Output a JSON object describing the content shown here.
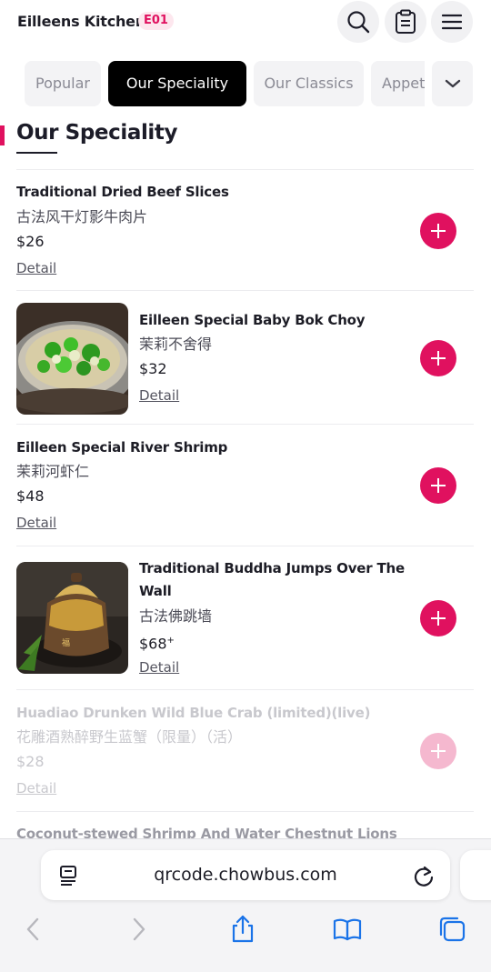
{
  "header": {
    "restaurant_name": "Eilleens Kitchen",
    "table_code": "E01",
    "icons": [
      "search-icon",
      "order-clipboard-icon",
      "menu-hamburger-icon"
    ]
  },
  "tabs": [
    {
      "label": "Popular",
      "active": false
    },
    {
      "label": "Our Speciality",
      "active": true
    },
    {
      "label": "Our Classics",
      "active": false
    },
    {
      "label": "Appetizers",
      "active": false
    }
  ],
  "section": {
    "title": "Our Speciality"
  },
  "items": [
    {
      "name": "Traditional Dried Beef Slices",
      "name_cn": "古法风干灯影牛肉片",
      "price": "$26",
      "detail_label": "Detail",
      "has_image": false,
      "available": true
    },
    {
      "name": "Eilleen Special Baby Bok Choy",
      "name_cn": "茉莉不舍得",
      "price": "$32",
      "detail_label": "Detail",
      "has_image": true,
      "image": "bok-choy-soup-photo",
      "available": true
    },
    {
      "name": "Eilleen Special River Shrimp",
      "name_cn": "茉莉河虾仁",
      "price": "$48",
      "detail_label": "Detail",
      "has_image": false,
      "available": true
    },
    {
      "name": "Traditional Buddha Jumps Over The Wall",
      "name_cn": "古法佛跳墙",
      "price": "$68",
      "price_suffix": "+",
      "detail_label": "Detail",
      "has_image": true,
      "image": "buddha-jumps-over-wall-photo",
      "available": true
    },
    {
      "name": "Huadiao Drunken Wild Blue Crab (limited)(live)",
      "name_cn": "花雕酒熟醉野生蓝蟹（限量）（活）",
      "price": "$28",
      "detail_label": "Detail",
      "has_image": false,
      "available": false
    },
    {
      "name": "Coconut-stewed Shrimp And Water Chestnut Lions",
      "available": true
    }
  ],
  "browser": {
    "url": "qrcode.chowbus.com",
    "icons": [
      "page-menu-icon",
      "reload-icon",
      "back-icon",
      "forward-icon",
      "share-icon",
      "bookmarks-icon",
      "tabs-icon"
    ]
  },
  "colors": {
    "accent": "#e0115f",
    "accent_faded": "#f5b8cf",
    "tab_active": "#000000"
  }
}
